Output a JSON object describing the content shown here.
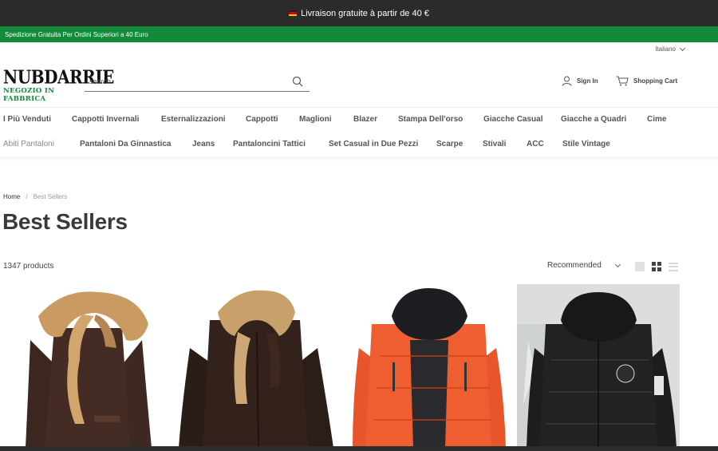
{
  "announcement": {
    "text": "Livraison gratuite à partir de 40 €"
  },
  "promo_bar": {
    "text": "Spedizione Gratuita Per Ordini Superiori a 40 Euro"
  },
  "language": {
    "label": "Italiano"
  },
  "logo": {
    "line1": "NUBDARRIE",
    "line2": "NEGOZIO IN FABBRICA"
  },
  "search": {
    "placeholder": "search"
  },
  "account": {
    "signin_label": "Sign In",
    "cart_label": "Shopping Cart"
  },
  "nav": {
    "row1": [
      "I Più Venduti",
      "Cappotti Invernali",
      "Esternalizzazioni",
      "Cappotti",
      "Maglioni",
      "Blazer",
      "Stampa Dell'orso",
      "Giacche Casual",
      "Giacche a Quadri",
      "Cime"
    ],
    "row2": [
      "Abiti Pantaloni",
      "Pantaloni Da Ginnastica",
      "Jeans",
      "Pantaloncini Tattici",
      "Set Casual in Due Pezzi",
      "Scarpe",
      "Stivali",
      "ACC",
      "Stile Vintage"
    ]
  },
  "breadcrumb": {
    "home": "Home",
    "separator": "/",
    "current": "Best Sellers"
  },
  "page": {
    "title": "Best Sellers",
    "product_count": "1347 products"
  },
  "sort": {
    "selected": "Recommended"
  },
  "colors": {
    "accent_green": "#118a3a",
    "topbar": "#2b2b2b"
  },
  "icons": [
    "flag-icon",
    "chevron-down-icon",
    "search-icon",
    "user-icon",
    "cart-icon",
    "large-view-icon",
    "grid-view-icon",
    "list-view-icon"
  ],
  "products": [
    {
      "name": "brown-shearling-jacket-with-hood"
    },
    {
      "name": "dark-brown-leather-shearling-jacket"
    },
    {
      "name": "orange-hooded-puffer-jacket"
    },
    {
      "name": "black-hooded-puffer-jacket"
    }
  ]
}
